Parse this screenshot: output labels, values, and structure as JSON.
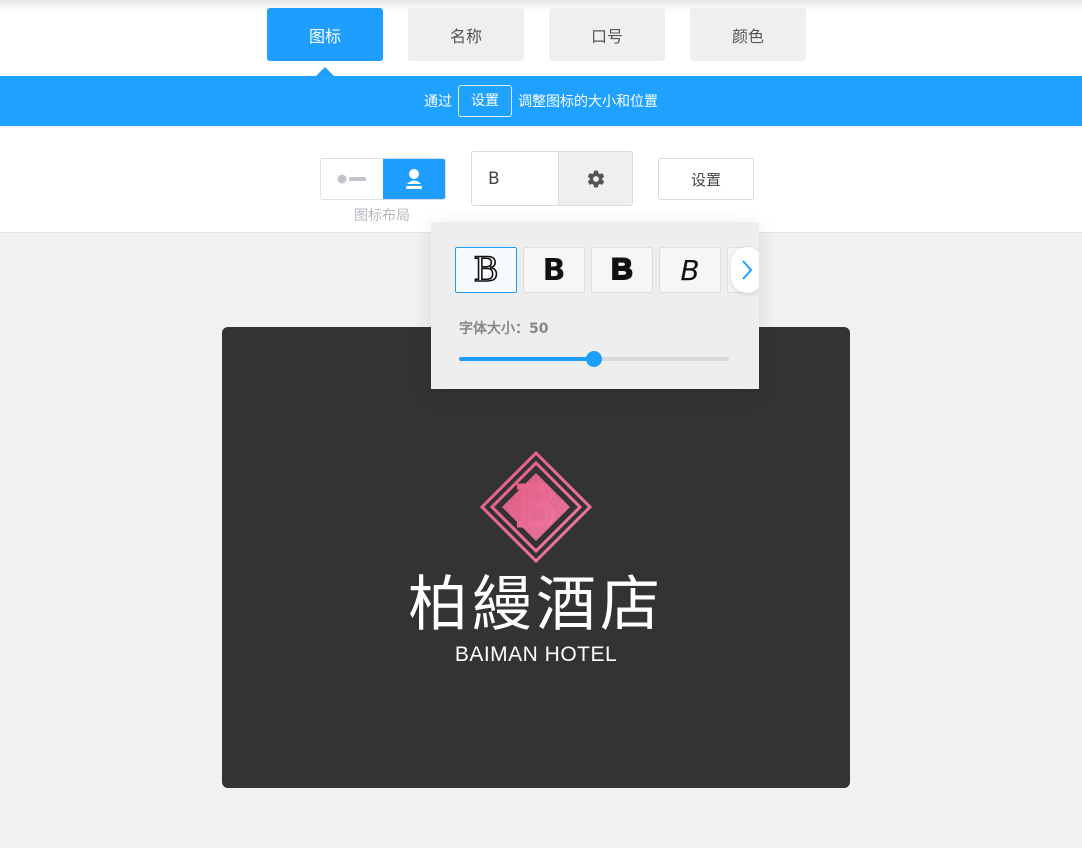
{
  "tabs": [
    {
      "label": "图标",
      "active": true
    },
    {
      "label": "名称",
      "active": false
    },
    {
      "label": "口号",
      "active": false
    },
    {
      "label": "颜色",
      "active": false
    }
  ],
  "hint": {
    "prefix": "通过",
    "button": "设置",
    "suffix": "调整图标的大小和位置"
  },
  "toolbar": {
    "layout_label": "图标布局",
    "layout_options": [
      "horizontal-icon",
      "vertical-icon"
    ],
    "layout_selected": 1,
    "font_value": "B",
    "settings_label": "设置"
  },
  "font_picker": {
    "options": [
      {
        "glyph": "B",
        "style": "outline-serif",
        "selected": true
      },
      {
        "glyph": "B",
        "style": "heavy-sans",
        "selected": false
      },
      {
        "glyph": "B",
        "style": "rounded-black",
        "selected": false
      },
      {
        "glyph": "B",
        "style": "thin-script",
        "selected": false
      }
    ],
    "size_label": "字体大小：50",
    "size_value": 50,
    "size_fraction": 0.5
  },
  "logo": {
    "letter": "B",
    "name": "柏縵酒店",
    "subtitle": "BAIMAN HOTEL",
    "emblem_colors": [
      "#e85d86",
      "#f07aa4"
    ],
    "text_color": "#ffffff",
    "background": "#333333"
  },
  "colors": {
    "accent": "#1e9eff",
    "hint_bar": "#1ea1ff"
  }
}
